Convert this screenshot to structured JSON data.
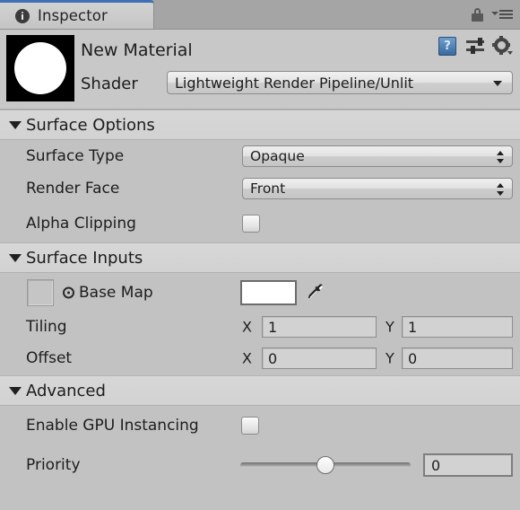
{
  "window": {
    "tab_label": "Inspector",
    "tab_icon": "info-circle-icon",
    "lock_icon": "lock-icon",
    "menu_icon": "hamburger-menu-icon",
    "accent_color": "#3f6fb5",
    "background_color": "#c2c2c2"
  },
  "material": {
    "name": "New Material",
    "preview_icon": "material-sphere-preview",
    "shader_label": "Shader",
    "shader_value": "Lightweight Render Pipeline/Unlit",
    "help_icon": "help-book-icon",
    "help_glyph": "?",
    "preset_icon": "preset-sliders-icon",
    "gear_icon": "gear-icon"
  },
  "surface_options": {
    "title": "Surface Options",
    "expanded": true,
    "surface_type": {
      "label": "Surface Type",
      "value": "Opaque"
    },
    "render_face": {
      "label": "Render Face",
      "value": "Front"
    },
    "alpha_clipping": {
      "label": "Alpha Clipping",
      "checked": false
    }
  },
  "surface_inputs": {
    "title": "Surface Inputs",
    "expanded": true,
    "base_map": {
      "label": "Base Map",
      "texture_value": "",
      "color_value": "#ffffff",
      "eyedropper_icon": "eyedropper-icon",
      "target_icon": "target-circle-icon"
    },
    "tiling": {
      "label": "Tiling",
      "x_label": "X",
      "x_value": "1",
      "y_label": "Y",
      "y_value": "1"
    },
    "offset": {
      "label": "Offset",
      "x_label": "X",
      "x_value": "0",
      "y_label": "Y",
      "y_value": "0"
    }
  },
  "advanced": {
    "title": "Advanced",
    "expanded": true,
    "gpu_instancing": {
      "label": "Enable GPU Instancing",
      "checked": false
    },
    "priority": {
      "label": "Priority",
      "value": "0"
    }
  }
}
